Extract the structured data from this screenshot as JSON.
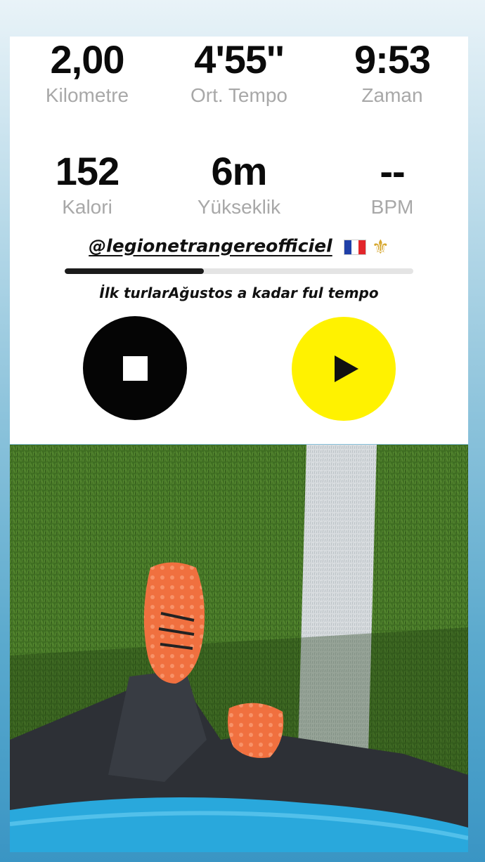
{
  "stats": [
    {
      "value": "2,00",
      "label": "Kilometre"
    },
    {
      "value": "4'55''",
      "label": "Ort. Tempo"
    },
    {
      "value": "9:53",
      "label": "Zaman"
    },
    {
      "value": "152",
      "label": "Kalori"
    },
    {
      "value": "6m",
      "label": "Yükseklik"
    },
    {
      "value": "--",
      "label": "BPM"
    }
  ],
  "story": {
    "mention": "@legionetrangereofficiel",
    "flag_icon": "france-flag-icon",
    "emblem_icon": "fleur-de-lis-icon",
    "progress": 0.4,
    "caption": "İlk turlarAğustos a kadar ful tempo"
  },
  "controls": {
    "stop_icon": "stop-icon",
    "play_icon": "play-icon"
  },
  "colors": {
    "stop_button": "#050505",
    "play_button": "#fff200",
    "shoe": "#f0703f",
    "turf": "#3c6a20",
    "shirt": "#29a8dc"
  }
}
